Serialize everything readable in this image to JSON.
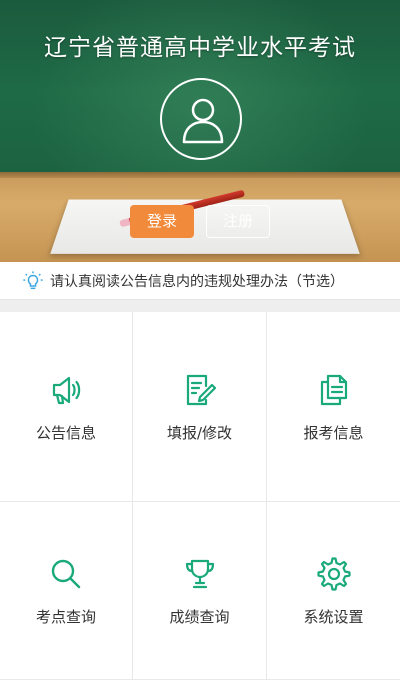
{
  "header": {
    "title": "辽宁省普通高中学业水平考试"
  },
  "auth": {
    "login_label": "登录",
    "register_label": "注册"
  },
  "notice": {
    "text": "请认真阅读公告信息内的违规处理办法（节选）",
    "icon": "lightbulb-icon"
  },
  "menu": {
    "items": [
      {
        "label": "公告信息",
        "icon": "megaphone-icon"
      },
      {
        "label": "填报/修改",
        "icon": "edit-form-icon"
      },
      {
        "label": "报考信息",
        "icon": "documents-icon"
      },
      {
        "label": "考点查询",
        "icon": "search-icon"
      },
      {
        "label": "成绩查询",
        "icon": "trophy-icon"
      },
      {
        "label": "系统设置",
        "icon": "gear-icon"
      }
    ]
  },
  "colors": {
    "accent": "#19a97b",
    "login_button": "#f28a3b",
    "notice_icon": "#3aa6e0"
  }
}
